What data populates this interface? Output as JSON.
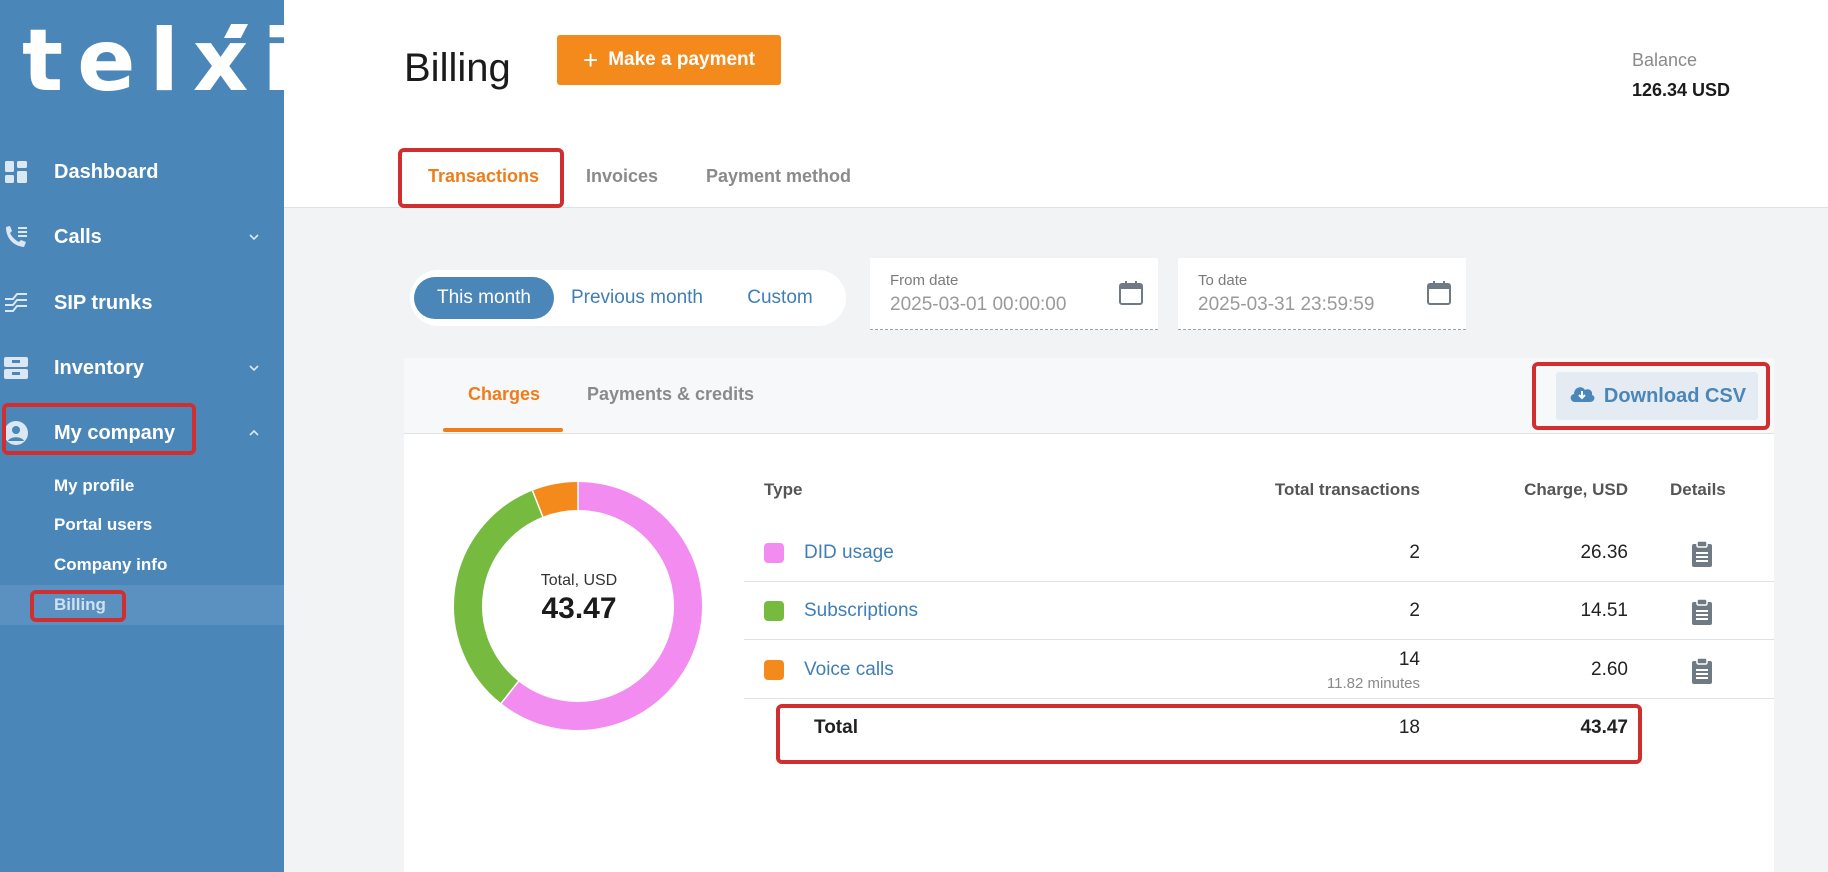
{
  "brand": {
    "logo_text": "telxi"
  },
  "sidebar": {
    "items": [
      {
        "label": "Dashboard",
        "icon": "dashboard-icon"
      },
      {
        "label": "Calls",
        "icon": "phone-list-icon",
        "chevron": "chevron-down-icon"
      },
      {
        "label": "SIP trunks",
        "icon": "sip-trunk-icon"
      },
      {
        "label": "Inventory",
        "icon": "inventory-icon",
        "chevron": "chevron-down-icon"
      },
      {
        "label": "My company",
        "icon": "company-user-icon",
        "chevron": "chevron-up-icon"
      }
    ],
    "subitems": [
      {
        "label": "My profile"
      },
      {
        "label": "Portal users"
      },
      {
        "label": "Company info"
      },
      {
        "label": "Billing",
        "active": true
      }
    ]
  },
  "header": {
    "title": "Billing",
    "make_payment_label": "Make a payment",
    "balance_label": "Balance",
    "balance_value": "126.34 USD",
    "tabs": [
      {
        "label": "Transactions",
        "active": true
      },
      {
        "label": "Invoices"
      },
      {
        "label": "Payment method"
      }
    ]
  },
  "filters": {
    "periods": [
      {
        "label": "This month",
        "active": true
      },
      {
        "label": "Previous month"
      },
      {
        "label": "Custom"
      }
    ],
    "from_label": "From date",
    "from_value": "2025-03-01 00:00:00",
    "to_label": "To date",
    "to_value": "2025-03-31 23:59:59"
  },
  "card": {
    "tabs": [
      {
        "label": "Charges",
        "active": true
      },
      {
        "label": "Payments & credits"
      }
    ],
    "download_label": "Download CSV",
    "donut_label": "Total, USD",
    "donut_value": "43.47",
    "columns": {
      "type": "Type",
      "total": "Total transactions",
      "charge": "Charge, USD",
      "details": "Details"
    },
    "rows": [
      {
        "type": "DID usage",
        "total": "2",
        "charge": "26.36",
        "color": "#f28cf0"
      },
      {
        "type": "Subscriptions",
        "total": "2",
        "charge": "14.51",
        "color": "#76bb40"
      },
      {
        "type": "Voice calls",
        "total": "14",
        "sub": "11.82 minutes",
        "charge": "2.60",
        "color": "#f48a1c"
      }
    ],
    "total_row": {
      "label": "Total",
      "total": "18",
      "charge": "43.47"
    }
  },
  "colors": {
    "sidebar": "#4b86b8",
    "accent": "#f48a1c",
    "link": "#3f7fb6",
    "highlight": "#d12f2f"
  }
}
